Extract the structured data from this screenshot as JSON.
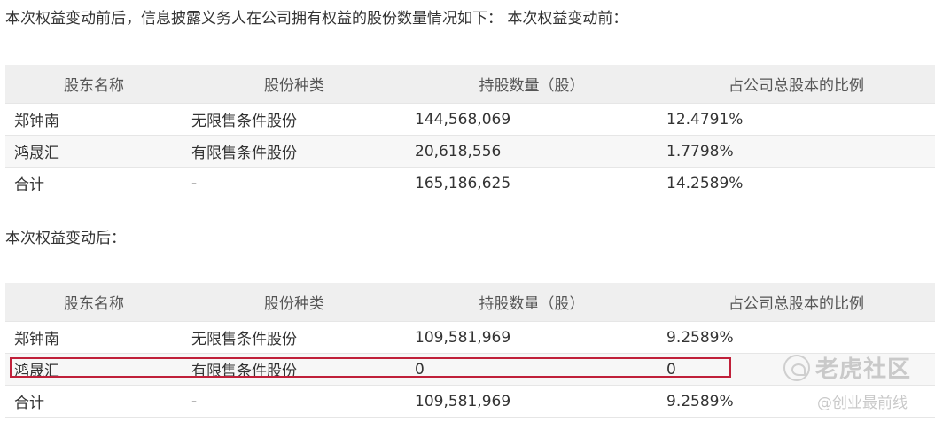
{
  "intro_text": "本次权益变动前后，信息披露义务人在公司拥有权益的股份数量情况如下：  本次权益变动前：",
  "after_text": "本次权益变动后：",
  "headers": [
    "股东名称",
    "股份种类",
    "持股数量（股）",
    "占公司总股本的比例"
  ],
  "before_rows": [
    [
      "郑钟南",
      "无限售条件股份",
      "144,568,069",
      "12.4791%"
    ],
    [
      "鸿晟汇",
      "有限售条件股份",
      "20,618,556",
      "1.7798%"
    ],
    [
      "合计",
      "-",
      "165,186,625",
      "14.2589%"
    ]
  ],
  "after_rows": [
    [
      "郑钟南",
      "无限售条件股份",
      "109,581,969",
      "9.2589%"
    ],
    [
      "鸿晟汇",
      "有限售条件股份",
      "0",
      "0"
    ],
    [
      "合计",
      "-",
      "109,581,969",
      "9.2589%"
    ]
  ],
  "watermark": {
    "main": "老虎社区",
    "sub": "@创业最前线"
  },
  "highlight_color": "#c0203a"
}
